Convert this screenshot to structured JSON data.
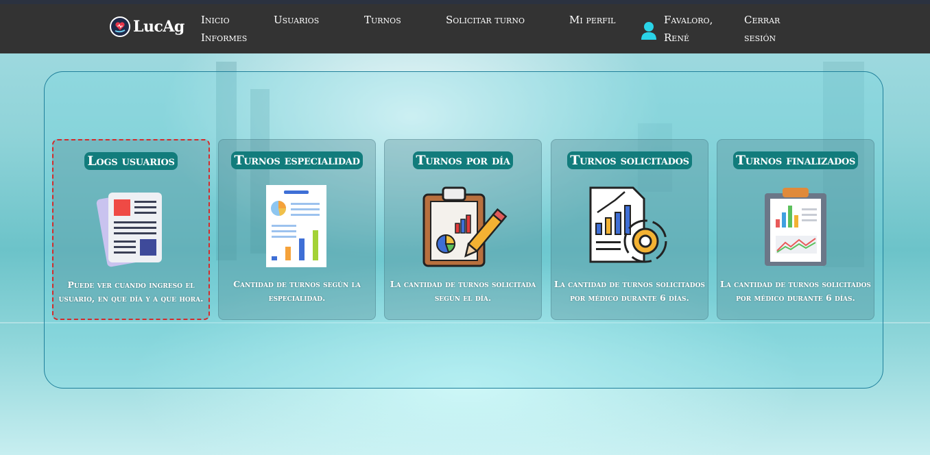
{
  "brand": {
    "name": "LucAg",
    "logo_icon": "heart-hand-icon"
  },
  "nav": {
    "inicio": "Inicio",
    "informes": "Informes",
    "usuarios": "Usuarios",
    "turnos": "Turnos",
    "solicitar_turno": "Solicitar turno",
    "mi_perfil": "Mi perfil",
    "user_icon": "user-icon",
    "user_name_line1": "Favaloro,",
    "user_name_line2": "René",
    "cerrar_line1": "Cerrar",
    "cerrar_line2": "sesión"
  },
  "colors": {
    "navbar": "#333333",
    "card_title_bg": "#127c7c",
    "user_icon": "#2ad4e8",
    "selected_border": "#d42a2a"
  },
  "cards": [
    {
      "title": "Logs usuarios",
      "icon": "document-log-icon",
      "description": "Puede ver cuando ingreso el usuario, en que día y a que hora.",
      "selected": true
    },
    {
      "title": "Turnos especialidad",
      "icon": "report-chart-icon",
      "description": "Cantidad de turnos según la especialidad.",
      "selected": false
    },
    {
      "title": "Turnos por día",
      "icon": "clipboard-chart-pencil-icon",
      "description": "La cantidad de turnos solicitada según el día.",
      "selected": false
    },
    {
      "title": "Turnos solicitados",
      "icon": "report-gear-icon",
      "description": "La cantidad de turnos solicitados por médico durante 6 días.",
      "selected": false
    },
    {
      "title": "Turnos finalizados",
      "icon": "clipboard-bar-line-icon",
      "description": "La cantidad de turnos solicitados por médico durante 6 días.",
      "selected": false
    }
  ]
}
